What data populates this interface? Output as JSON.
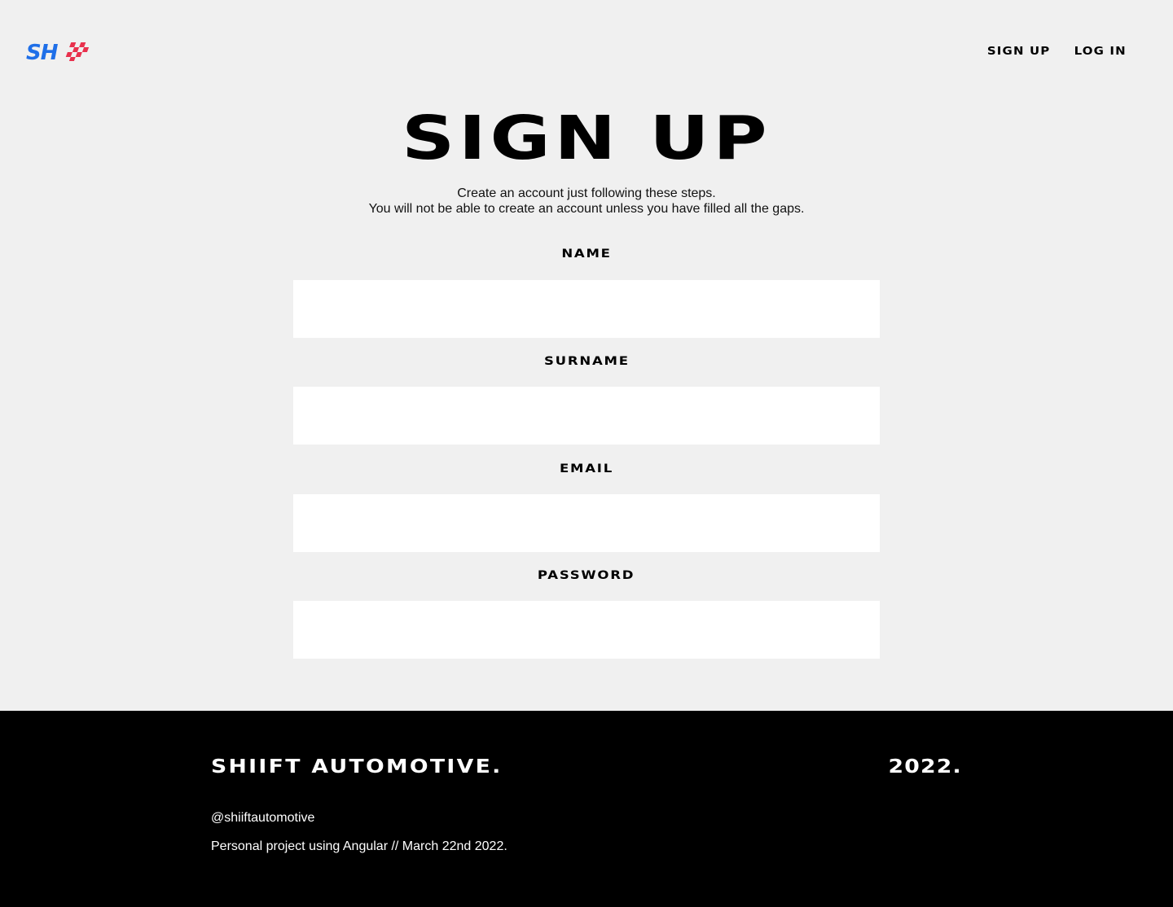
{
  "header": {
    "logo_text": "SH",
    "nav": [
      {
        "label": "SIGN UP"
      },
      {
        "label": "LOG IN"
      }
    ]
  },
  "colors": {
    "background": "#f0f0f0",
    "logo_blue": "#1f6fe8",
    "logo_red": "#e8314d",
    "footer_bg": "#000000",
    "input_bg": "#ffffff"
  },
  "main": {
    "title": "SIGN UP",
    "subtitle_line1": "Create an account just following these steps.",
    "subtitle_line2": "You will not be able to create an account unless you have filled all the gaps.",
    "fields": [
      {
        "label": "NAME",
        "value": "",
        "placeholder": ""
      },
      {
        "label": "SURNAME",
        "value": "",
        "placeholder": ""
      },
      {
        "label": "EMAIL",
        "value": "",
        "placeholder": ""
      },
      {
        "label": "PASSWORD",
        "value": "",
        "placeholder": ""
      }
    ]
  },
  "footer": {
    "brand": "SHIIFT AUTOMOTIVE.",
    "year": "2022.",
    "handle": "@shiiftautomotive",
    "credit": "Personal project using Angular // March 22nd 2022."
  }
}
